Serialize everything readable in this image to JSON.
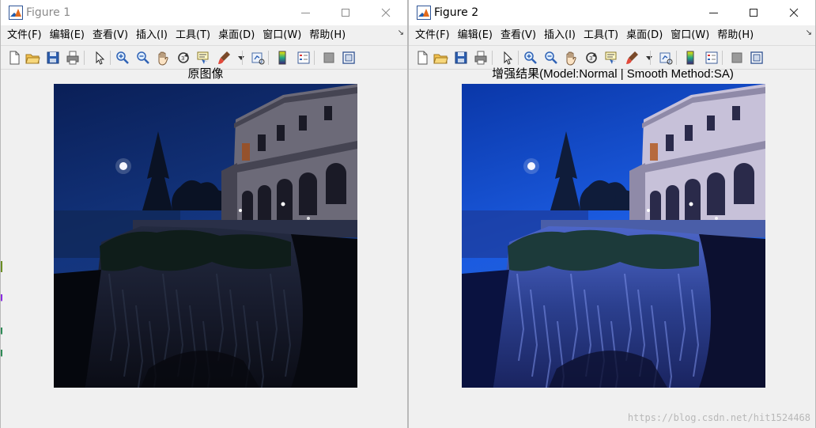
{
  "figures": [
    {
      "title": "Figure 1",
      "menu": [
        "文件(F)",
        "编辑(E)",
        "查看(V)",
        "插入(I)",
        "工具(T)",
        "桌面(D)",
        "窗口(W)",
        "帮助(H)"
      ],
      "axes_title": "原图像",
      "image_variant": "original"
    },
    {
      "title": "Figure 2",
      "menu": [
        "文件(F)",
        "编辑(E)",
        "查看(V)",
        "插入(I)",
        "工具(T)",
        "桌面(D)",
        "窗口(W)",
        "帮助(H)"
      ],
      "axes_title": "增强结果(Model:Normal | Smooth Method:SA)",
      "image_variant": "enhanced"
    }
  ],
  "toolbar_icons": [
    "new-figure-icon",
    "open-file-icon",
    "save-icon",
    "print-icon",
    "pointer-icon",
    "zoom-in-icon",
    "zoom-out-icon",
    "pan-hand-icon",
    "rotate-3d-icon",
    "data-cursor-icon",
    "brush-icon",
    "brush-dropdown-icon",
    "link-plot-icon",
    "colorbar-icon",
    "legend-icon",
    "hide-plot-tools-icon",
    "show-plot-tools-icon"
  ],
  "colors": {
    "window_bg": "#f0f0f0",
    "titlebar_bg": "#ffffff",
    "inactive_title": "#8a8a8a",
    "matlab_orange": "#e26a1c",
    "matlab_blue": "#1f5fb3"
  },
  "watermark": "https://blog.csdn.net/hit1524468"
}
